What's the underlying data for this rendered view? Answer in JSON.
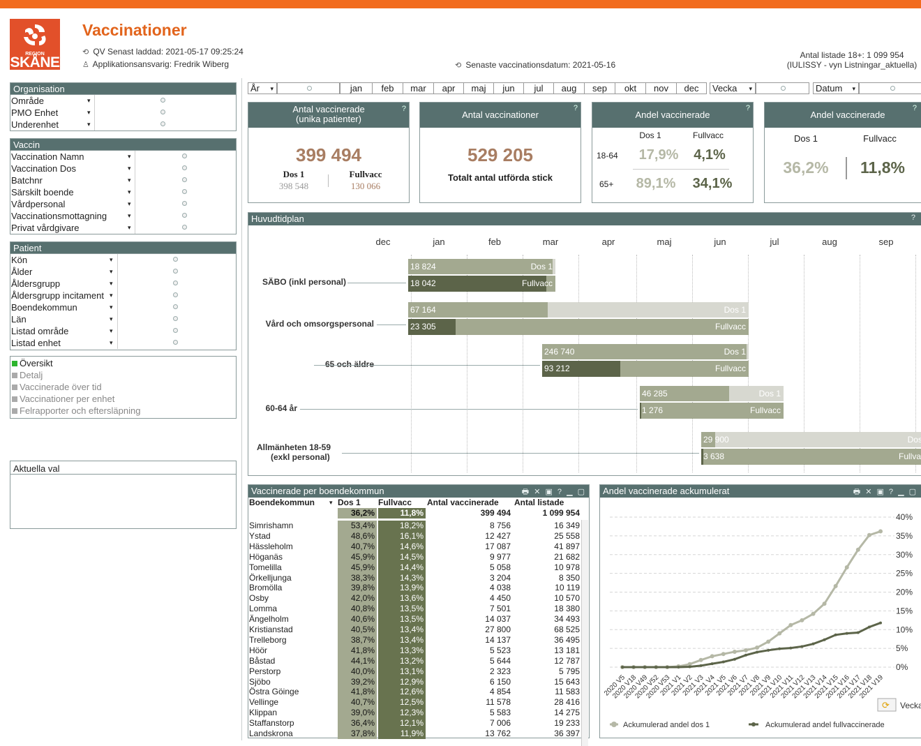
{
  "header": {
    "title": "Vaccinationer",
    "logo_small": "REGION",
    "logo_big": "SKÅNE",
    "qv_loaded": "QV Senast laddad: 2021-05-17 09:25:24",
    "app_owner": "Applikationsansvarig: Fredrik Wiberg",
    "latest_date": "Senaste vaccinationsdatum: 2021-05-16",
    "listed_count": "Antal listade 18+: 1 099 954",
    "listed_source": "(IULISSY - vyn Listningar_aktuella)"
  },
  "colors": {
    "accent": "#f26b1d",
    "header_bg": "#57706f",
    "brand": "#e2502a",
    "dos1": "#a3a990",
    "fullvacc": "#68734f",
    "kpi_value": "#a87d62"
  },
  "sidebar": {
    "org_title": "Organisation",
    "org_items": [
      "Område",
      "PMO Enhet",
      "Underenhet"
    ],
    "vaccin_title": "Vaccin",
    "vaccin_items": [
      "Vaccination Namn",
      "Vaccination Dos",
      "Batchnr",
      "Särskilt boende",
      "Vårdpersonal",
      "Vaccinationsmottagning",
      "Privat vårdgivare"
    ],
    "patient_title": "Patient",
    "patient_items": [
      "Kön",
      "Ålder",
      "Åldersgrupp",
      "Åldersgrupp incitament",
      "Boendekommun",
      "Län",
      "Listad område",
      "Listad enhet"
    ],
    "tabs": [
      "Översikt",
      "Detalj",
      "Vaccinerade över tid",
      "Vaccinationer per enhet",
      "Felrapporter och eftersläpning"
    ],
    "current_title": "Aktuella val"
  },
  "filters": {
    "year": "År",
    "months": [
      "jan",
      "feb",
      "mar",
      "apr",
      "maj",
      "jun",
      "jul",
      "aug",
      "sep",
      "okt",
      "nov",
      "dec"
    ],
    "week": "Vecka",
    "date": "Datum"
  },
  "kpi": {
    "k1_title1": "Antal vaccinerade",
    "k1_title2": "(unika patienter)",
    "k1_value": "399 494",
    "k1_dos_label": "Dos 1",
    "k1_dos_value": "398 548",
    "k1_full_label": "Fullvacc",
    "k1_full_value": "130 066",
    "k2_title": "Antal vaccinationer",
    "k2_value": "529 205",
    "k2_sub": "Totalt antal utförda stick",
    "k3_title": "Andel vaccinerade",
    "k3_col1": "Dos 1",
    "k3_col2": "Fullvacc",
    "k3_r1": "18-64",
    "k3_r1_d": "17,9%",
    "k3_r1_f": "4,1%",
    "k3_r2": "65+",
    "k3_r2_d": "89,1%",
    "k3_r2_f": "34,1%",
    "k4_title": "Andel vaccinerade",
    "k4_col1": "Dos 1",
    "k4_col2": "Fullvacc",
    "k4_d": "36,2%",
    "k4_f": "11,8%",
    "help": "?"
  },
  "timeline": {
    "title": "Huvudtidplan",
    "months": [
      "dec",
      "jan",
      "feb",
      "mar",
      "apr",
      "maj",
      "jun",
      "jul",
      "aug",
      "sep"
    ],
    "dos_label": "Dos 1",
    "full_label": "Fullvacc",
    "groups": [
      {
        "name": "SÄBO (inkl personal)",
        "dos": "18 824",
        "full": "18 042",
        "dos_progress": 0.98,
        "full_progress": 0.94
      },
      {
        "name": "Vård och omsorgspersonal",
        "dos": "67 164",
        "full": "23 305",
        "dos_progress": 0.41,
        "full_progress": 0.14
      },
      {
        "name": "65 och äldre",
        "dos": "246 740",
        "full": "93 212",
        "dos_progress": 0.99,
        "full_progress": 0.38
      },
      {
        "name": "60-64 år",
        "dos": "46 285",
        "full": "1 276",
        "dos_progress": 0.62,
        "full_progress": 0.01
      },
      {
        "name": "Allmänheten 18-59",
        "name2": "(exkl personal)",
        "dos": "29 900",
        "full": "3 638",
        "dos_progress": 0.06,
        "full_progress": 0.01
      }
    ]
  },
  "table": {
    "title": "Vaccinerade per boendekommun",
    "icons": "🖶 ✕ ▣ ? ▁ ▢",
    "headers": [
      "Boendekommun",
      "Dos 1",
      "Fullvacc",
      "Antal vaccinerade",
      "Antal listade"
    ],
    "totals": [
      "",
      "36,2%",
      "11,8%",
      "399 494",
      "1 099 954"
    ],
    "rows": [
      [
        "Simrishamn",
        "53,4%",
        "18,2%",
        "8 756",
        "16 349"
      ],
      [
        "Ystad",
        "48,6%",
        "16,1%",
        "12 427",
        "25 558"
      ],
      [
        "Hässleholm",
        "40,7%",
        "14,6%",
        "17 087",
        "41 897"
      ],
      [
        "Höganäs",
        "45,9%",
        "14,5%",
        "9 977",
        "21 682"
      ],
      [
        "Tomelilla",
        "45,9%",
        "14,4%",
        "5 058",
        "10 978"
      ],
      [
        "Örkelljunga",
        "38,3%",
        "14,3%",
        "3 204",
        "8 350"
      ],
      [
        "Bromölla",
        "39,8%",
        "13,9%",
        "4 038",
        "10 119"
      ],
      [
        "Osby",
        "42,0%",
        "13,6%",
        "4 450",
        "10 570"
      ],
      [
        "Lomma",
        "40,8%",
        "13,5%",
        "7 501",
        "18 380"
      ],
      [
        "Ängelholm",
        "40,6%",
        "13,5%",
        "14 037",
        "34 493"
      ],
      [
        "Kristianstad",
        "40,5%",
        "13,4%",
        "27 800",
        "68 525"
      ],
      [
        "Trelleborg",
        "38,7%",
        "13,4%",
        "14 137",
        "36 495"
      ],
      [
        "Höör",
        "41,8%",
        "13,3%",
        "5 523",
        "13 181"
      ],
      [
        "Båstad",
        "44,1%",
        "13,2%",
        "5 644",
        "12 787"
      ],
      [
        "Perstorp",
        "40,0%",
        "13,1%",
        "2 323",
        "5 795"
      ],
      [
        "Sjöbo",
        "39,2%",
        "12,9%",
        "6 150",
        "15 643"
      ],
      [
        "Östra Göinge",
        "41,8%",
        "12,6%",
        "4 854",
        "11 583"
      ],
      [
        "Vellinge",
        "40,7%",
        "12,5%",
        "11 578",
        "28 416"
      ],
      [
        "Klippan",
        "39,0%",
        "12,3%",
        "5 583",
        "14 275"
      ],
      [
        "Staffanstorp",
        "36,4%",
        "12,1%",
        "7 006",
        "19 233"
      ],
      [
        "Landskrona",
        "37,8%",
        "11,9%",
        "13 762",
        "36 397"
      ]
    ]
  },
  "chart_panel": {
    "title": "Andel vaccinerade ackumulerat",
    "icons": "🖶 ✕ ▣ ? ▁ ▢",
    "cycle_label": "Vecka"
  },
  "chart_data": {
    "type": "line",
    "title": "Andel vaccinerade ackumulerat",
    "x": [
      "2020 V5",
      "2020 V18",
      "2020 V49",
      "2020 V52",
      "2020 V53",
      "2021 V1",
      "2021 V2",
      "2021 V3",
      "2021 V4",
      "2021 V5",
      "2021 V6",
      "2021 V7",
      "2021 V8",
      "2021 V9",
      "2021 V10",
      "2021 V11",
      "2021 V12",
      "2021 V13",
      "2021 V14",
      "2021 V15",
      "2021 V16",
      "2021 V17",
      "2021 V18",
      "2021 V19"
    ],
    "y_ticks": [
      "0%",
      "5%",
      "10%",
      "15%",
      "20%",
      "25%",
      "30%",
      "35%",
      "40%"
    ],
    "ylim": [
      0,
      40
    ],
    "grid": true,
    "legend": "bottom",
    "series": [
      {
        "name": "Ackumulerad andel dos 1",
        "color": "#b5b8a6",
        "values": [
          0,
          0,
          0,
          0,
          0,
          0.2,
          0.8,
          1.9,
          2.9,
          3.5,
          4.1,
          4.5,
          5.2,
          6.8,
          9.0,
          11.2,
          12.5,
          14.2,
          16.9,
          21.6,
          26.6,
          31.3,
          35.2,
          36.2
        ]
      },
      {
        "name": "Ackumulerad andel fullvaccinerade",
        "color": "#5c6449",
        "values": [
          0,
          0,
          0,
          0,
          0,
          0,
          0.1,
          0.4,
          0.9,
          1.4,
          2.1,
          3.2,
          4.0,
          4.5,
          4.9,
          5.1,
          5.5,
          6.2,
          7.3,
          8.6,
          9.0,
          9.2,
          10.7,
          11.8
        ]
      }
    ]
  }
}
